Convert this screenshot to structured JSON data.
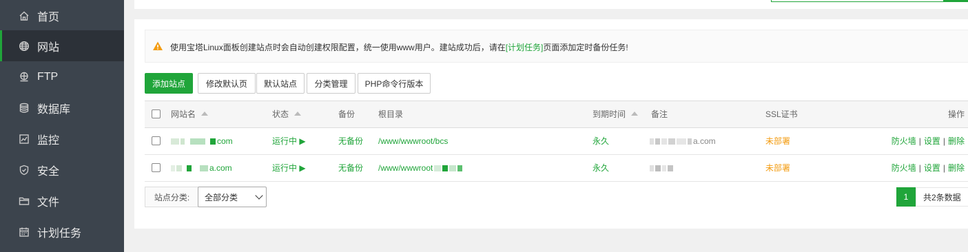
{
  "sidebar": {
    "items": [
      {
        "label": "首页",
        "icon": "home-icon"
      },
      {
        "label": "网站",
        "icon": "globe-icon"
      },
      {
        "label": "FTP",
        "icon": "ftp-icon"
      },
      {
        "label": "数据库",
        "icon": "database-icon"
      },
      {
        "label": "监控",
        "icon": "monitor-icon"
      },
      {
        "label": "安全",
        "icon": "shield-icon"
      },
      {
        "label": "文件",
        "icon": "folder-icon"
      },
      {
        "label": "计划任务",
        "icon": "calendar-icon"
      }
    ]
  },
  "notice": {
    "text_before": "使用宝塔Linux面板创建站点时会自动创建权限配置，统一使用www用户。建站成功后，请在",
    "link": "[计划任务]",
    "text_after": "页面添加定时备份任务!"
  },
  "toolbar": {
    "add_site": "添加站点",
    "modify_default_page": "修改默认页",
    "default_site": "默认站点",
    "category_manage": "分类管理",
    "php_cli_version": "PHP命令行版本"
  },
  "table": {
    "headers": {
      "site_name": "网站名",
      "status": "状态",
      "backup": "备份",
      "root": "根目录",
      "expire": "到期时间",
      "remark": "备注",
      "ssl": "SSL证书",
      "actions": "操作"
    },
    "rows": [
      {
        "site_name": "com",
        "status": "运行中 ▶",
        "backup": "无备份",
        "root": "/www/wwwroot/bcs",
        "expire": "永久",
        "remark": "a.com",
        "ssl": "未部署"
      },
      {
        "site_name": "a.com",
        "status": "运行中 ▶",
        "backup": "无备份",
        "root": "/www/wwwroot",
        "expire": "永久",
        "remark": "",
        "ssl": "未部署"
      }
    ],
    "actions": {
      "firewall": "防火墙",
      "settings": "设置",
      "delete": "删除",
      "separator": "|"
    }
  },
  "footer": {
    "category_label": "站点分类:",
    "category_value": "全部分类",
    "current_page": "1",
    "total": "共2条数据"
  },
  "colors": {
    "accent": "#20a53a",
    "sidebar": "#3c444d",
    "warning": "#f39c12"
  }
}
